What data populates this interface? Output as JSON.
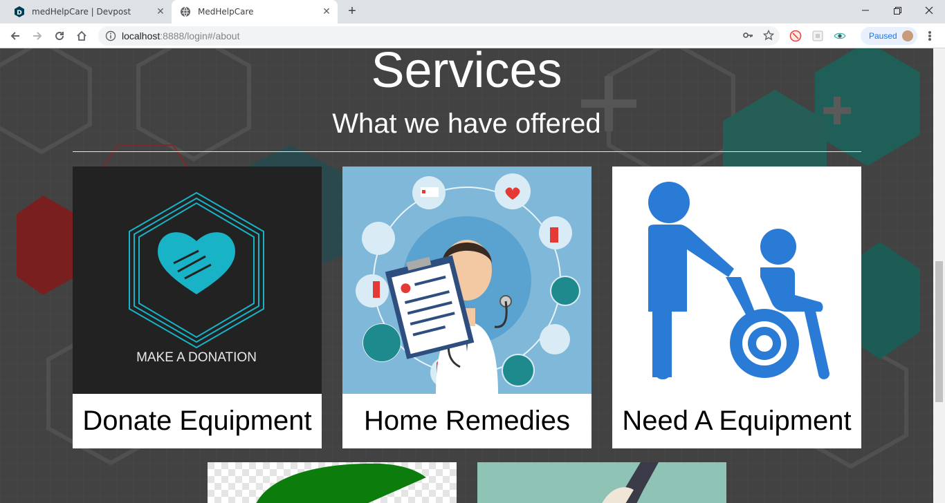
{
  "browser": {
    "tabs": [
      {
        "title": "medHelpCare | Devpost",
        "favicon_icon": "devpost-icon",
        "active": false
      },
      {
        "title": "MedHelpCare",
        "favicon_icon": "globe-icon",
        "active": true
      }
    ],
    "new_tab_label": "+",
    "close_label": "✕",
    "url_host": "localhost",
    "url_rest": ":8888/login#/about",
    "profile_status": "Paused"
  },
  "page": {
    "heading": "Services",
    "subheading": "What we have offered",
    "cards": [
      {
        "caption": "Donate Equipment",
        "image_text": "MAKE A DONATION"
      },
      {
        "caption": "Home Remedies"
      },
      {
        "caption": "Need A Equipment"
      }
    ]
  },
  "colors": {
    "overlay": "#424242",
    "donation_bg": "#222222",
    "teal": "#18b3c6",
    "remedies_bg": "#7fb8d9",
    "wheelchair_blue": "#2a7bd6"
  }
}
